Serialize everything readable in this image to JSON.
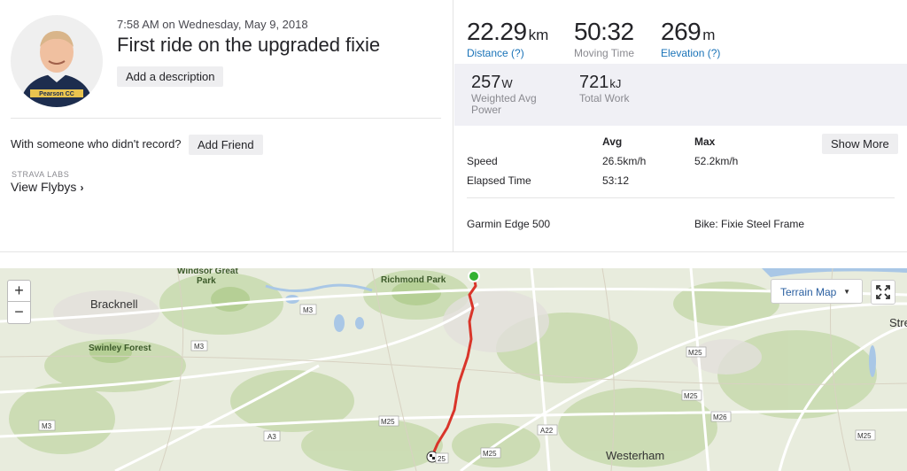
{
  "activity": {
    "datetime": "7:58 AM on Wednesday, May 9, 2018",
    "title": "First ride on the upgraded fixie",
    "add_description_label": "Add a description",
    "avatar_jersey_text": "Pearson CC"
  },
  "friends": {
    "prompt": "With someone who didn't record?",
    "add_friend_label": "Add Friend"
  },
  "labs": {
    "caption": "STRAVA LABS",
    "flybys_label": "View Flybys"
  },
  "stats": {
    "distance": {
      "value": "22.29",
      "unit": "km",
      "label": "Distance (?)"
    },
    "moving_time": {
      "value": "50:32",
      "label": "Moving Time"
    },
    "elevation": {
      "value": "269",
      "unit": "m",
      "label": "Elevation (?)"
    },
    "weighted_power": {
      "value": "257",
      "unit": "W",
      "label_line1": "Weighted Avg",
      "label_line2": "Power"
    },
    "total_work": {
      "value": "721",
      "unit": "kJ",
      "label": "Total Work"
    }
  },
  "details": {
    "col_avg": "Avg",
    "col_max": "Max",
    "show_more_label": "Show More",
    "rows": [
      {
        "label": "Speed",
        "avg": "26.5km/h",
        "max": "52.2km/h"
      },
      {
        "label": "Elapsed Time",
        "avg": "53:12",
        "max": ""
      }
    ],
    "device": "Garmin Edge 500",
    "bike": "Bike: Fixie Steel Frame"
  },
  "map": {
    "zoom_in": "+",
    "zoom_out": "−",
    "terrain_label": "Terrain Map",
    "places": {
      "windsor_great": "Windsor Great",
      "park": "Park",
      "richmond_park": "Richmond Park",
      "bracknell": "Bracknell",
      "swinley_forest": "Swinley Forest",
      "westerham": "Westerham",
      "stre": "Stre"
    },
    "roads": {
      "m3_a": "M3",
      "m3_b": "M3",
      "m3_c": "M3",
      "a3": "A3",
      "a22": "A22",
      "m25_a": "M25",
      "m25_b": "M25",
      "m25_c": "M25",
      "m25_d": "M25",
      "m25_e": "M25",
      "m26": "M26",
      "m25_partial": "25"
    },
    "route_color": "#d9352a",
    "start_color": "#34b233"
  }
}
